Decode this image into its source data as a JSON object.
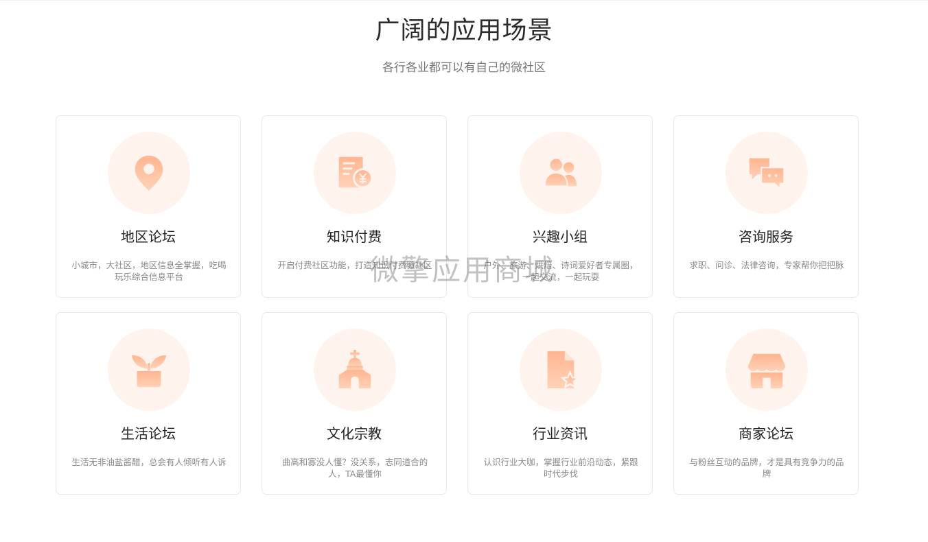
{
  "header": {
    "title": "广阔的应用场景",
    "subtitle": "各行各业都可以有自己的微社区"
  },
  "colors": {
    "icon_gradient_start": "#ffb894",
    "icon_gradient_end": "#ffcdb0",
    "icon_circle_bg": "#fff3ee"
  },
  "cards": [
    {
      "icon": "location-pin-icon",
      "title": "地区论坛",
      "desc": "小城市，大社区，地区信息全掌握，吃喝玩乐综合信息平台"
    },
    {
      "icon": "paid-document-icon",
      "title": "知识付费",
      "desc": "开启付费社区功能，打造知识付费微社区"
    },
    {
      "icon": "users-group-icon",
      "title": "兴趣小组",
      "desc": "户外、旅游、烘焙、诗词爱好者专属圈，一起交流，一起玩耍"
    },
    {
      "icon": "chat-bubbles-icon",
      "title": "咨询服务",
      "desc": "求职、问诊、法律咨询，专家帮你把把脉"
    },
    {
      "icon": "potted-plant-icon",
      "title": "生活论坛",
      "desc": "生活无非油盐酱醋，总会有人倾听有人诉"
    },
    {
      "icon": "church-icon",
      "title": "文化宗教",
      "desc": "曲高和寡没人懂？没关系，志同道合的人，TA最懂你"
    },
    {
      "icon": "starred-document-icon",
      "title": "行业资讯",
      "desc": "认识行业大咖，掌握行业前沿动态，紧跟时代步伐"
    },
    {
      "icon": "storefront-icon",
      "title": "商家论坛",
      "desc": "与粉丝互动的品牌，才是具有竞争力的品牌"
    }
  ],
  "watermark": "微擎应用商城"
}
